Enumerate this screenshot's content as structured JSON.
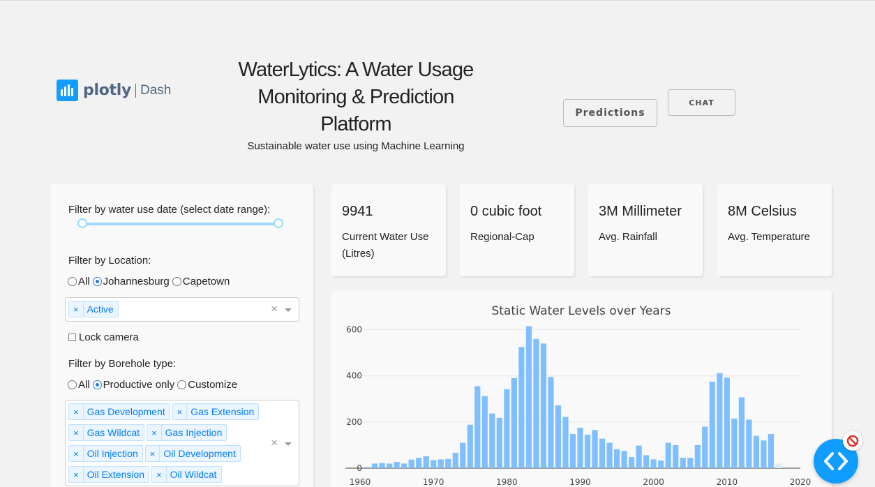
{
  "header": {
    "logo": {
      "icon": "plotly-bars-icon",
      "word": "plotly",
      "product": "Dash",
      "color": "#119dff"
    },
    "title": "WaterLytics: A Water Usage Monitoring & Prediction Platform",
    "subtitle": "Sustainable water use using Machine Learning",
    "predictions_label": "Predictions",
    "chat_label": "CHAT"
  },
  "filters": {
    "date_label": "Filter by water use date (select date range):",
    "location_label": "Filter by Location:",
    "location_options": [
      {
        "label": "All",
        "selected": false
      },
      {
        "label": "Johannesburg",
        "selected": true
      },
      {
        "label": "Capetown",
        "selected": false
      }
    ],
    "status_tags": [
      "Active"
    ],
    "lock_camera_label": "Lock camera",
    "borehole_label": "Filter by Borehole type:",
    "borehole_options": [
      {
        "label": "All",
        "selected": false
      },
      {
        "label": "Productive only",
        "selected": true
      },
      {
        "label": "Customize",
        "selected": false
      }
    ],
    "borehole_tags": [
      "Gas Development",
      "Gas Extension",
      "Gas Wildcat",
      "Gas Injection",
      "Oil Injection",
      "Oil Development",
      "Oil Extension",
      "Oil Wildcat"
    ],
    "clear_symbol": "×",
    "remove_symbol": "×"
  },
  "cards": [
    {
      "value": "9941",
      "label": "Current Water Use (Litres)"
    },
    {
      "value": "0 cubic foot",
      "label": "Regional-Cap"
    },
    {
      "value": "3M Millimeter",
      "label": "Avg. Rainfall"
    },
    {
      "value": "8M Celsius",
      "label": "Avg. Temperature"
    }
  ],
  "chart_data": {
    "type": "bar",
    "title": "Static Water Levels over Years",
    "x": [
      1960,
      1961,
      1962,
      1963,
      1964,
      1965,
      1966,
      1967,
      1968,
      1969,
      1970,
      1971,
      1972,
      1973,
      1974,
      1975,
      1976,
      1977,
      1978,
      1979,
      1980,
      1981,
      1982,
      1983,
      1984,
      1985,
      1986,
      1987,
      1988,
      1989,
      1990,
      1991,
      1992,
      1993,
      1994,
      1995,
      1996,
      1997,
      1998,
      1999,
      2000,
      2001,
      2002,
      2003,
      2004,
      2005,
      2006,
      2007,
      2008,
      2009,
      2010,
      2011,
      2012,
      2013,
      2014,
      2015,
      2016,
      2017
    ],
    "values": [
      0,
      5,
      20,
      22,
      20,
      27,
      20,
      37,
      45,
      52,
      35,
      38,
      40,
      67,
      110,
      188,
      355,
      312,
      237,
      218,
      342,
      390,
      525,
      615,
      560,
      540,
      395,
      272,
      222,
      148,
      175,
      145,
      165,
      128,
      110,
      82,
      75,
      48,
      98,
      56,
      38,
      33,
      110,
      100,
      45,
      45,
      100,
      180,
      375,
      412,
      392,
      215,
      307,
      210,
      140,
      120,
      148,
      20,
      25
    ],
    "bar_color": "#7fbfff",
    "faded_bar_color": "#dcebfa",
    "faded_from_year": 2016,
    "xlim": [
      1958,
      2020
    ],
    "ylim": [
      0,
      650
    ],
    "x_ticks": [
      1960,
      1970,
      1980,
      1990,
      2000,
      2010,
      2020
    ],
    "y_ticks": [
      0,
      200,
      400,
      600
    ],
    "grid": true
  },
  "fab": {
    "icon": "code-brackets-icon",
    "badge_icon": "no-entry-icon",
    "color": "#119dff"
  }
}
